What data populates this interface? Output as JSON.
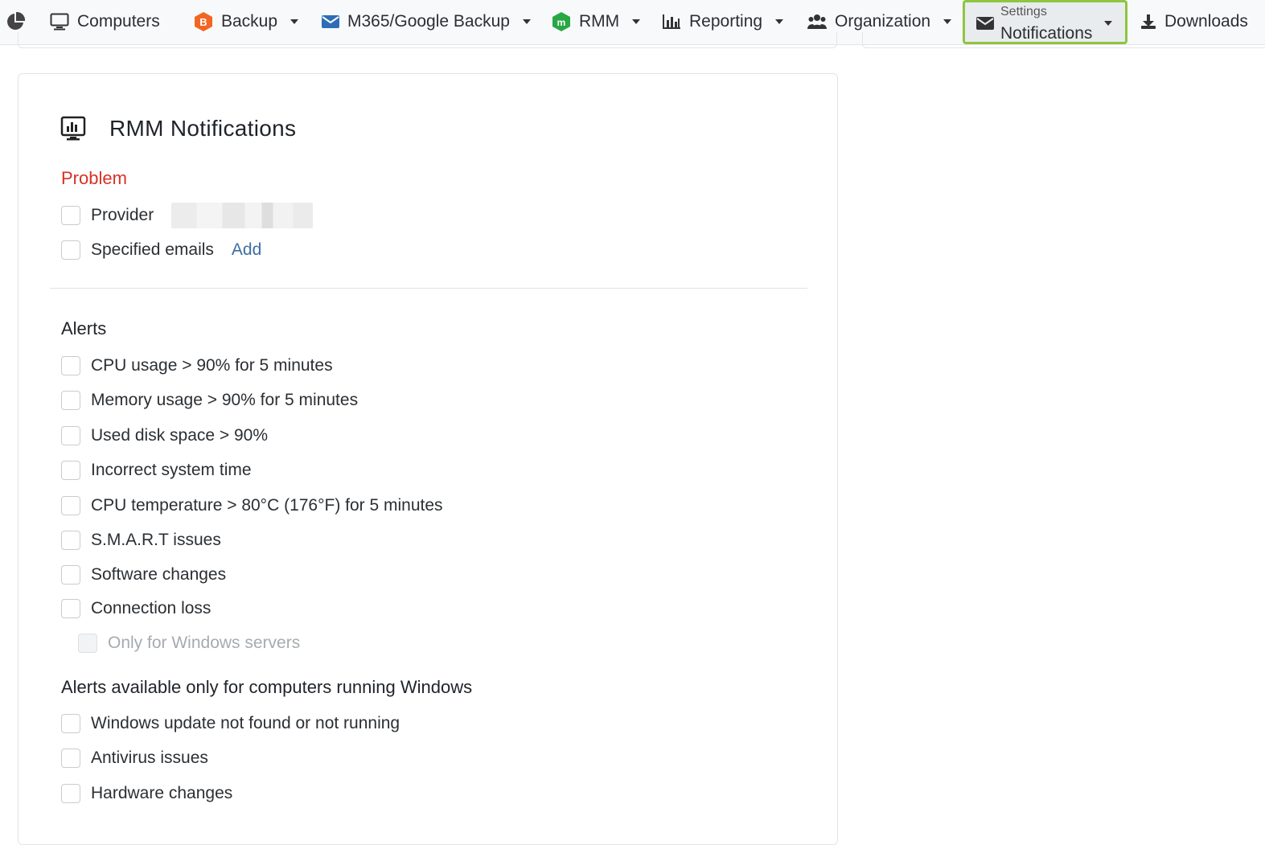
{
  "nav": {
    "items": [
      {
        "label": "Computers"
      },
      {
        "label": "Backup"
      },
      {
        "label": "M365/Google Backup"
      },
      {
        "label": "RMM"
      },
      {
        "label": "Reporting"
      },
      {
        "label": "Organization"
      }
    ],
    "settings": {
      "small": "Settings",
      "big": "Notifications"
    },
    "downloads": "Downloads"
  },
  "colors": {
    "accent_highlight": "#8dc63f",
    "problem_red": "#d93025",
    "link_blue": "#3a6ea5",
    "backup_orange": "#f26522",
    "rmm_green": "#28a745",
    "mail_blue": "#2e6db4"
  },
  "card": {
    "title": "RMM Notifications",
    "problem": {
      "heading": "Problem",
      "provider_label": "Provider",
      "specified_emails_label": "Specified emails",
      "add_link": "Add"
    },
    "alerts": {
      "heading": "Alerts",
      "items": [
        "CPU usage > 90% for 5 minutes",
        "Memory usage > 90% for 5 minutes",
        "Used disk space > 90%",
        "Incorrect system time",
        "CPU temperature > 80°C (176°F) for 5 minutes",
        "S.M.A.R.T issues",
        "Software changes",
        "Connection loss"
      ],
      "sub_option": "Only for Windows servers"
    },
    "windows_alerts": {
      "heading": "Alerts available only for computers running Windows",
      "items": [
        "Windows update not found or not running",
        "Antivirus issues",
        "Hardware changes"
      ]
    }
  }
}
